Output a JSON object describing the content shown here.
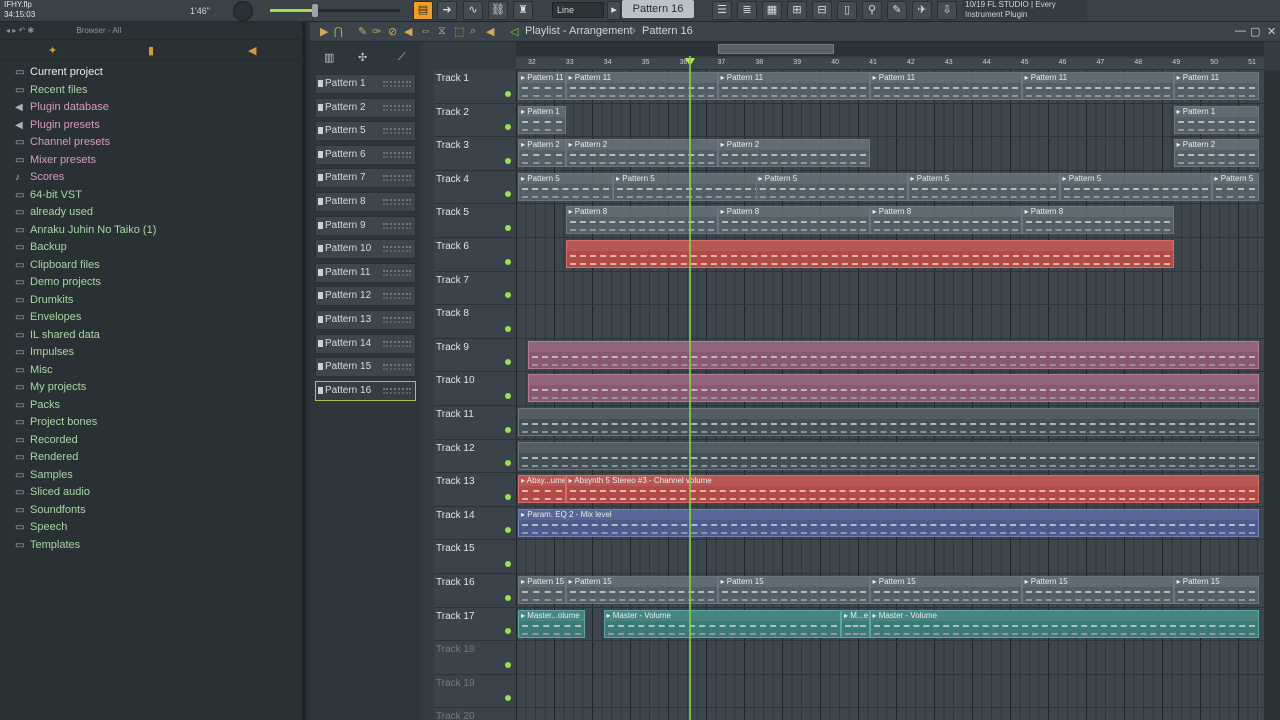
{
  "toolbar": {
    "project_name": "IFHY.flp",
    "song_time": "34:15:03",
    "tempo_display": "1'46\"",
    "snap": "Line",
    "pattern": "Pattern 16",
    "hint_line1": "10/19  FL STUDIO | Every",
    "hint_line2": "Instrument Plugin"
  },
  "browser": {
    "header": "Browser - All",
    "items": [
      {
        "label": "Current project",
        "icon": "folder-icon",
        "style": "current"
      },
      {
        "label": "Recent files",
        "icon": "folder-icon",
        "style": "green"
      },
      {
        "label": "Plugin database",
        "icon": "plugin-icon",
        "style": "pink"
      },
      {
        "label": "Plugin presets",
        "icon": "plugin-icon",
        "style": "pink"
      },
      {
        "label": "Channel presets",
        "icon": "folder-icon",
        "style": "pink"
      },
      {
        "label": "Mixer presets",
        "icon": "folder-icon",
        "style": "pink"
      },
      {
        "label": "Scores",
        "icon": "note-icon",
        "style": "pink"
      },
      {
        "label": "64-bit VST",
        "icon": "folder-icon",
        "style": "green"
      },
      {
        "label": "already used",
        "icon": "folder-icon",
        "style": "green"
      },
      {
        "label": "Anraku Juhin No Taiko (1)",
        "icon": "folder-icon",
        "style": "green"
      },
      {
        "label": "Backup",
        "icon": "folder-icon",
        "style": "green"
      },
      {
        "label": "Clipboard files",
        "icon": "folder-icon",
        "style": "green"
      },
      {
        "label": "Demo projects",
        "icon": "folder-icon",
        "style": "green"
      },
      {
        "label": "Drumkits",
        "icon": "folder-icon",
        "style": "green"
      },
      {
        "label": "Envelopes",
        "icon": "folder-icon",
        "style": "green"
      },
      {
        "label": "IL shared data",
        "icon": "folder-icon",
        "style": "green"
      },
      {
        "label": "Impulses",
        "icon": "folder-icon",
        "style": "green"
      },
      {
        "label": "Misc",
        "icon": "folder-icon",
        "style": "green"
      },
      {
        "label": "My projects",
        "icon": "folder-icon",
        "style": "green"
      },
      {
        "label": "Packs",
        "icon": "folder-icon",
        "style": "green"
      },
      {
        "label": "Project bones",
        "icon": "folder-icon",
        "style": "green"
      },
      {
        "label": "Recorded",
        "icon": "folder-icon",
        "style": "green"
      },
      {
        "label": "Rendered",
        "icon": "folder-icon",
        "style": "green"
      },
      {
        "label": "Samples",
        "icon": "folder-icon",
        "style": "green"
      },
      {
        "label": "Sliced audio",
        "icon": "folder-icon",
        "style": "green"
      },
      {
        "label": "Soundfonts",
        "icon": "folder-icon",
        "style": "green"
      },
      {
        "label": "Speech",
        "icon": "folder-icon",
        "style": "green"
      },
      {
        "label": "Templates",
        "icon": "folder-icon",
        "style": "green"
      }
    ]
  },
  "playlist": {
    "title": "Playlist - Arrangement",
    "current_pattern": "Pattern 16",
    "patterns": [
      "Pattern 1",
      "Pattern 2",
      "Pattern 5",
      "Pattern 6",
      "Pattern 7",
      "Pattern 8",
      "Pattern 9",
      "Pattern 10",
      "Pattern 11",
      "Pattern 12",
      "Pattern 13",
      "Pattern 14",
      "Pattern 15",
      "Pattern 16"
    ],
    "selected_pattern_index": 13,
    "ruler": [
      "32",
      "33",
      "34",
      "35",
      "36",
      "37",
      "38",
      "39",
      "40",
      "41",
      "42",
      "43",
      "44",
      "45",
      "46",
      "47",
      "48",
      "49",
      "50",
      "51"
    ],
    "tracks": [
      {
        "name": "Track 1",
        "clips": [
          {
            "label": "Pattern 11",
            "start": 0,
            "len": 5
          },
          {
            "label": "Pattern 11",
            "start": 5,
            "len": 16
          },
          {
            "label": "Pattern 11",
            "start": 21,
            "len": 16
          },
          {
            "label": "Pattern 11",
            "start": 37,
            "len": 16
          },
          {
            "label": "Pattern 11",
            "start": 53,
            "len": 16
          },
          {
            "label": "Pattern 11",
            "start": 69,
            "len": 9
          }
        ]
      },
      {
        "name": "Track 2",
        "clips": [
          {
            "label": "Pattern 1",
            "start": 0,
            "len": 5
          },
          {
            "label": "Pattern 1",
            "start": 69,
            "len": 9
          }
        ]
      },
      {
        "name": "Track 3",
        "clips": [
          {
            "label": "Pattern 2",
            "start": 0,
            "len": 5
          },
          {
            "label": "Pattern 2",
            "start": 5,
            "len": 16
          },
          {
            "label": "Pattern 2",
            "start": 21,
            "len": 16
          },
          {
            "label": "Pattern 2",
            "start": 69,
            "len": 9
          }
        ]
      },
      {
        "name": "Track 4",
        "clips": [
          {
            "label": "Pattern 5",
            "start": 0,
            "len": 10
          },
          {
            "label": "Pattern 5",
            "start": 10,
            "len": 16
          },
          {
            "label": "Pattern 5",
            "start": 25,
            "len": 16
          },
          {
            "label": "Pattern 5",
            "start": 41,
            "len": 16
          },
          {
            "label": "Pattern 5",
            "start": 57,
            "len": 16
          },
          {
            "label": "Pattern 5",
            "start": 73,
            "len": 5
          }
        ]
      },
      {
        "name": "Track 5",
        "clips": [
          {
            "label": "Pattern 8",
            "start": 5,
            "len": 16
          },
          {
            "label": "Pattern 8",
            "start": 21,
            "len": 16
          },
          {
            "label": "Pattern 8",
            "start": 37,
            "len": 16
          },
          {
            "label": "Pattern 8",
            "start": 53,
            "len": 16
          }
        ]
      },
      {
        "name": "Track 6",
        "clips": [
          {
            "label": "",
            "start": 5,
            "len": 64,
            "style": "red"
          }
        ]
      },
      {
        "name": "Track 7",
        "clips": []
      },
      {
        "name": "Track 8",
        "clips": []
      },
      {
        "name": "Track 9",
        "clips": [
          {
            "label": "",
            "start": 1,
            "len": 77,
            "style": "pink"
          }
        ]
      },
      {
        "name": "Track 10",
        "clips": [
          {
            "label": "",
            "start": 1,
            "len": 77,
            "style": "pink"
          }
        ]
      },
      {
        "name": "Track 11",
        "clips": [
          {
            "label": "",
            "start": 0,
            "len": 78,
            "style": "dark"
          }
        ]
      },
      {
        "name": "Track 12",
        "clips": [
          {
            "label": "",
            "start": 0,
            "len": 78,
            "style": "dark"
          }
        ]
      },
      {
        "name": "Track 13",
        "clips": [
          {
            "label": "Absy...ume",
            "start": 0,
            "len": 5,
            "style": "red"
          },
          {
            "label": "Absynth 5 Stereo #3 - Channel volume",
            "start": 5,
            "len": 73,
            "style": "red"
          }
        ]
      },
      {
        "name": "Track 14",
        "clips": [
          {
            "label": "Param. EQ 2 - Mix level",
            "start": 0,
            "len": 78,
            "style": "blue"
          }
        ]
      },
      {
        "name": "Track 15",
        "clips": []
      },
      {
        "name": "Track 16",
        "clips": [
          {
            "label": "Pattern 15",
            "start": 0,
            "len": 5
          },
          {
            "label": "Pattern 15",
            "start": 5,
            "len": 16
          },
          {
            "label": "Pattern 15",
            "start": 21,
            "len": 16
          },
          {
            "label": "Pattern 15",
            "start": 37,
            "len": 16
          },
          {
            "label": "Pattern 15",
            "start": 53,
            "len": 16
          },
          {
            "label": "Pattern 15",
            "start": 69,
            "len": 9
          }
        ]
      },
      {
        "name": "Track 17",
        "clips": [
          {
            "label": "Master...olume",
            "start": 0,
            "len": 7,
            "style": "teal"
          },
          {
            "label": "Master - Volume",
            "start": 9,
            "len": 25,
            "style": "teal"
          },
          {
            "label": "M...e",
            "start": 34,
            "len": 3,
            "style": "teal"
          },
          {
            "label": "Master - Volume",
            "start": 37,
            "len": 41,
            "style": "teal"
          }
        ]
      },
      {
        "name": "Track 18",
        "clips": [],
        "dim": true
      },
      {
        "name": "Track 19",
        "clips": [],
        "dim": true
      },
      {
        "name": "Track 20",
        "clips": [],
        "dim": true
      }
    ],
    "playhead_beat": 18
  }
}
